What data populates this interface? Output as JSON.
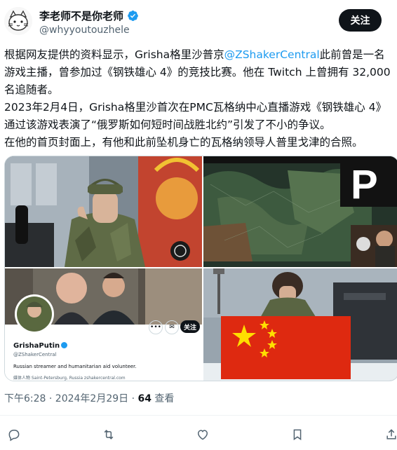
{
  "header": {
    "display_name": "李老师不是你老师",
    "handle": "@whyyoutouzhele",
    "follow_label": "关注"
  },
  "tweet": {
    "line1_before": "根据网友提供的资料显示，Grisha格里沙普京",
    "mention": "@ZShakerCentral",
    "line1_after": "此前曾是一名游戏主播，曾参加过《钢铁雄心 4》的竞技比赛。他在 Twitch 上曾拥有 32,000 名追随者。",
    "para2": "2023年2月4日，Grisha格里沙首次在PMC瓦格纳中心直播游戏《钢铁雄心 4》通过该游戏表演了“俄罗斯如何短时间战胜北约”引发了不小的争议。",
    "para3": "在他的首页封面上，有他和此前坠机身亡的瓦格纳领导人普里戈津的合照。"
  },
  "media": {
    "profile_card": {
      "name": "GrishaPutin",
      "handle": "@ZShakerCentral",
      "bio": "Russian streamer and humanitarian aid volunteer.",
      "meta": "媒体人物  Saint-Petersburg, Russia  zshakercentral.com",
      "follow_label": "关注"
    },
    "game_logo_letter": "P"
  },
  "meta": {
    "time": "下午6:28 · 2024年2月29日 · ",
    "views_count": "64",
    "views_label": " 查看"
  },
  "colors": {
    "accent": "#1d9bf0",
    "text": "#0f1419",
    "muted": "#536471",
    "flag_red": "#de2910",
    "flag_star": "#ffde00"
  },
  "icons": {
    "reply": "reply-icon",
    "retweet": "retweet-icon",
    "like": "heart-icon",
    "bookmark": "bookmark-icon",
    "share": "share-icon"
  }
}
